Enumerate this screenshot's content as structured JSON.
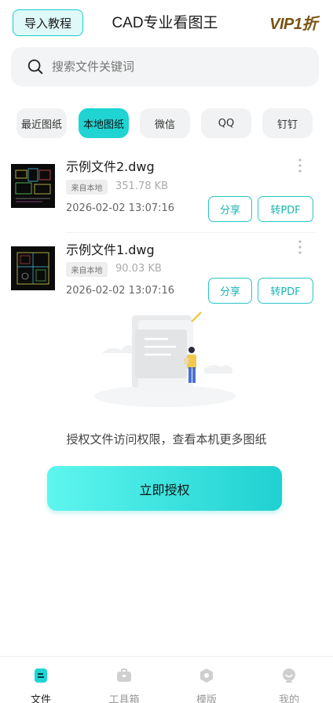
{
  "header": {
    "tutorial_label": "导入教程",
    "title": "CAD专业看图王",
    "vip_label": "VIP1折"
  },
  "search": {
    "placeholder": "搜索文件关键词"
  },
  "tabs": [
    {
      "label": "最近图纸",
      "active": false
    },
    {
      "label": "本地图纸",
      "active": true
    },
    {
      "label": "微信",
      "active": false
    },
    {
      "label": "QQ",
      "active": false
    },
    {
      "label": "钉钉",
      "active": false
    }
  ],
  "files": [
    {
      "name": "示例文件2.dwg",
      "source": "来自本地",
      "size": "351.78 KB",
      "date": "2026-02-02 13:07:16",
      "share_label": "分享",
      "pdf_label": "转PDF"
    },
    {
      "name": "示例文件1.dwg",
      "source": "来自本地",
      "size": "90.03 KB",
      "date": "2026-02-02 13:07:16",
      "share_label": "分享",
      "pdf_label": "转PDF"
    }
  ],
  "auth": {
    "message": "授权文件访问权限，查看本机更多图纸",
    "button_label": "立即授权"
  },
  "bottom_nav": [
    {
      "label": "文件",
      "icon": "file-icon",
      "active": true
    },
    {
      "label": "工具箱",
      "icon": "toolbox-icon",
      "active": false
    },
    {
      "label": "模版",
      "icon": "template-icon",
      "active": false
    },
    {
      "label": "我的",
      "icon": "profile-icon",
      "active": false
    }
  ],
  "colors": {
    "accent": "#20d4d4",
    "vip": "#7a5412"
  }
}
